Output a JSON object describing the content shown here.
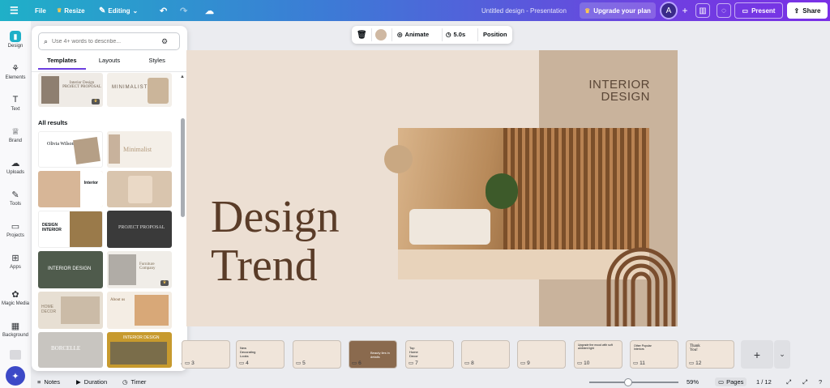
{
  "app": {
    "menu_icon": "hamburger-icon",
    "file_label": "File",
    "resize_label": "Resize",
    "editing_label": "Editing",
    "doc_title": "Untitled design - Presentation",
    "upgrade_label": "Upgrade your plan",
    "avatar_letter": "A",
    "present_label": "Present",
    "share_label": "Share"
  },
  "rail": [
    {
      "label": "Design",
      "icon": "design-icon"
    },
    {
      "label": "Elements",
      "icon": "elements-icon"
    },
    {
      "label": "Text",
      "icon": "text-icon"
    },
    {
      "label": "Brand",
      "icon": "brand-icon"
    },
    {
      "label": "Uploads",
      "icon": "uploads-icon"
    },
    {
      "label": "Tools",
      "icon": "tools-icon"
    },
    {
      "label": "Projects",
      "icon": "projects-icon"
    },
    {
      "label": "Apps",
      "icon": "apps-icon"
    },
    {
      "label": "Magic Media",
      "icon": "magic-media-icon"
    },
    {
      "label": "Background",
      "icon": "background-icon"
    }
  ],
  "panel": {
    "search_placeholder": "Use 4+ words to describe...",
    "tabs": [
      "Templates",
      "Layouts",
      "Styles"
    ],
    "section": "All results",
    "templates": {
      "t1": "Interior Design PROJECT PROPOSAL",
      "t2": "MINIMALIST",
      "t3a": "Olivia Wilson",
      "t4": "Minimalist",
      "t5": "Interior",
      "t7a": "DESIGN INTERIOR",
      "t8": "PROJECT PROPOSAL",
      "t9": "INTERIOR DESIGN",
      "t10": "Furniture Company",
      "t11": "HOME DECOR",
      "t12": "About us",
      "t13": "BORCELLE",
      "t14": "INTERIOR DESIGN"
    }
  },
  "canvas_toolbar": {
    "animate": "Animate",
    "duration": "5.0s",
    "position": "Position",
    "color": "#cfb8a2"
  },
  "slide": {
    "corner_title_1": "INTERIOR",
    "corner_title_2": "DESIGN",
    "headline_1": "Design",
    "headline_2": "Trend",
    "bg": "#ecdfd3",
    "accent": "#c9a882",
    "text_color": "#5a3c28"
  },
  "pages": [
    {
      "num": "3",
      "text": ""
    },
    {
      "num": "4",
      "text": "New Decorating Looks"
    },
    {
      "num": "5",
      "text": ""
    },
    {
      "num": "6",
      "text": "Beauty lies in details"
    },
    {
      "num": "7",
      "text": "Top Home Decor"
    },
    {
      "num": "8",
      "text": ""
    },
    {
      "num": "9",
      "text": ""
    },
    {
      "num": "10",
      "text": "Upgrade the mood with soft ambient light"
    },
    {
      "num": "11",
      "text": "Other Popular Interiors"
    },
    {
      "num": "12",
      "text": "Thank You!"
    }
  ],
  "bottom": {
    "notes": "Notes",
    "duration": "Duration",
    "timer": "Timer",
    "zoom": "59%",
    "pages_label": "Pages",
    "page_counter": "1 / 12"
  }
}
